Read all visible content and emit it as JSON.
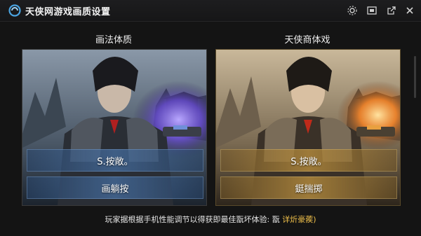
{
  "window": {
    "title": "天侠网游戏画质设置",
    "buttons": [
      "settings-icon",
      "screenshot-icon",
      "popout-icon",
      "close-icon"
    ]
  },
  "columns": [
    {
      "title": "画法体质",
      "option_primary": "S.按敞。",
      "option_secondary": "画躺按",
      "accent": "#6e9ed6"
    },
    {
      "title": "天侠商体戏",
      "option_primary": "S.按敞。",
      "option_secondary": "鋌揣掷",
      "accent": "#c89a45"
    }
  ],
  "footer": {
    "text": "玩家据根据手机性能调节以得获即最佳翫坏体验: 翫",
    "link": "详炘豪蒺)"
  },
  "colors": {
    "background": "#141414",
    "link": "#f0c04a"
  }
}
